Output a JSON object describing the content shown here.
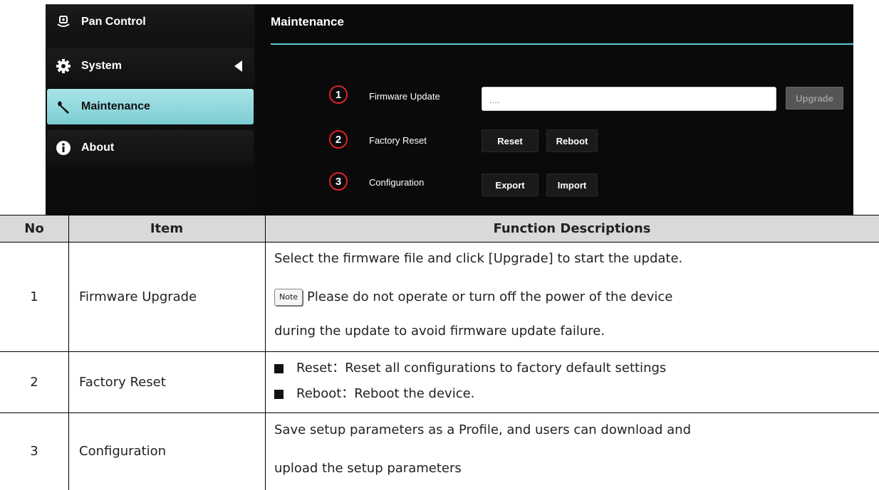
{
  "sidebar": {
    "items": [
      {
        "label": "Pan Control",
        "icon": "pan-control-icon"
      },
      {
        "label": "System",
        "icon": "gear-icon"
      },
      {
        "label": "Maintenance",
        "icon": "wrench-icon",
        "active": true
      },
      {
        "label": "About",
        "icon": "info-icon"
      }
    ]
  },
  "main": {
    "title": "Maintenance",
    "rows": [
      {
        "number": "1",
        "label": "Firmware Update"
      },
      {
        "number": "2",
        "label": "Factory Reset"
      },
      {
        "number": "3",
        "label": "Configuration"
      }
    ],
    "firmware_input_value": "....",
    "upgrade_label": "Upgrade",
    "reset_label": "Reset",
    "reboot_label": "Reboot",
    "export_label": "Export",
    "import_label": "Import"
  },
  "table": {
    "headers": {
      "no": "No",
      "item": "Item",
      "desc": "Function Descriptions"
    },
    "rows": [
      {
        "no": "1",
        "item": "Firmware Upgrade",
        "line1": "Select the firmware file and click [Upgrade] to start the update.",
        "note_label": "Note",
        "line2": "Please do not operate or turn off the power of the device",
        "line3": "during the update to avoid firmware update failure."
      },
      {
        "no": "2",
        "item": "Factory Reset",
        "bullets": [
          "Reset：Reset all configurations to factory default settings",
          "Reboot：Reboot the device."
        ]
      },
      {
        "no": "3",
        "item": "Configuration",
        "line1": "Save setup parameters as a Profile, and users can download and",
        "line2": "upload the setup parameters"
      }
    ]
  },
  "colors": {
    "accent": "#7ccdd3",
    "marker": "#e0202a",
    "header_bg": "#d9d9d9"
  }
}
